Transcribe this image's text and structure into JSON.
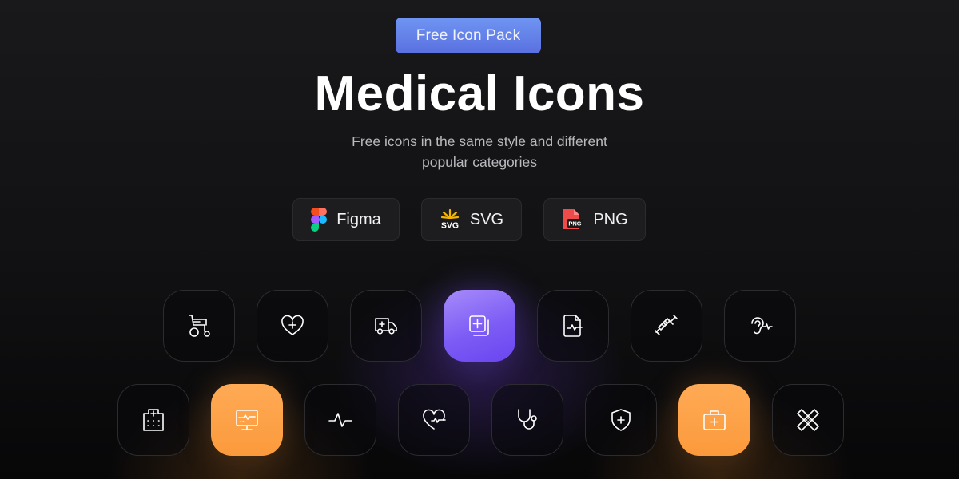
{
  "header": {
    "badge_label": "Free Icon Pack",
    "title": "Medical Icons",
    "subtitle_line1": "Free icons in the same style and different",
    "subtitle_line2": "popular categories"
  },
  "formats": [
    {
      "label": "Figma",
      "icon": "figma-icon"
    },
    {
      "label": "SVG",
      "icon": "svg-file-icon"
    },
    {
      "label": "PNG",
      "icon": "png-file-icon"
    }
  ],
  "icons_row1": [
    {
      "name": "wheelchair-icon",
      "style": "outline"
    },
    {
      "name": "heart-plus-icon",
      "style": "outline"
    },
    {
      "name": "ambulance-icon",
      "style": "outline"
    },
    {
      "name": "add-copy-icon",
      "style": "purple"
    },
    {
      "name": "medical-report-icon",
      "style": "outline"
    },
    {
      "name": "syringe-icon",
      "style": "outline"
    },
    {
      "name": "ear-hearing-icon",
      "style": "outline"
    }
  ],
  "icons_row2": [
    {
      "name": "hospital-icon",
      "style": "outline"
    },
    {
      "name": "heart-monitor-icon",
      "style": "orange"
    },
    {
      "name": "pulse-icon",
      "style": "outline"
    },
    {
      "name": "heartbeat-icon",
      "style": "outline"
    },
    {
      "name": "stethoscope-icon",
      "style": "outline"
    },
    {
      "name": "shield-plus-icon",
      "style": "outline"
    },
    {
      "name": "first-aid-kit-icon",
      "style": "orange"
    },
    {
      "name": "bandage-icon",
      "style": "outline"
    }
  ],
  "colors": {
    "badge": "#5f7fe8",
    "purple_accent": "#7c5cf5",
    "orange_accent": "#fb9a3c",
    "background": "#141416"
  }
}
